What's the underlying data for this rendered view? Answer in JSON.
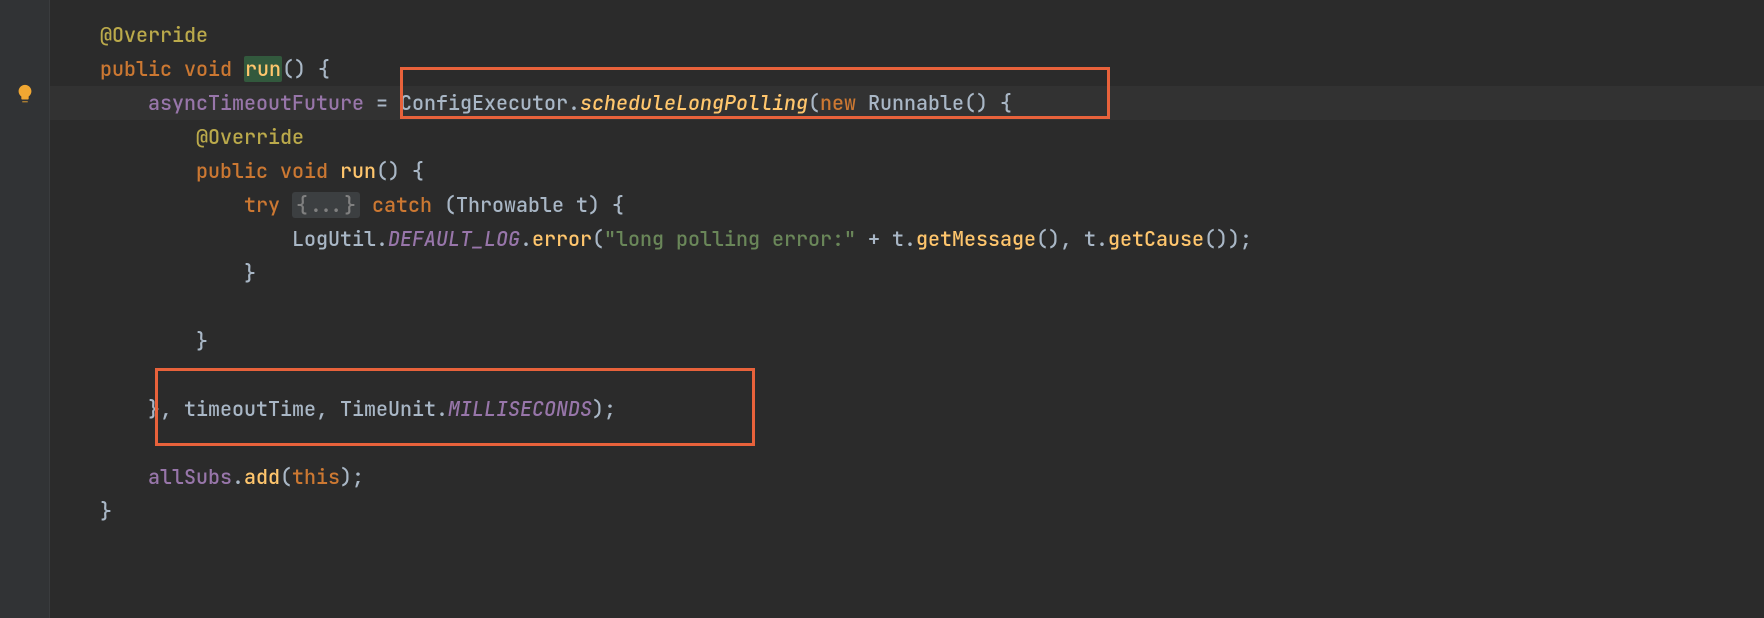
{
  "icons": {
    "bulb": "lightbulb-icon"
  },
  "code": {
    "l1": {
      "annot": "@Override"
    },
    "l2": {
      "kw1": "public",
      "kw2": "void",
      "name": "run",
      "p": "() {"
    },
    "l3": {
      "field": "asyncTimeoutFuture",
      "eq": " = ",
      "cls": "ConfigExecutor",
      "dot": ".",
      "m": "scheduleLongPolling",
      "open": "(",
      "kwnew": "new",
      "sp": " ",
      "rtype": "Runnable",
      "tail": "() {"
    },
    "l4": {
      "annot": "@Override"
    },
    "l5": {
      "kw1": "public",
      "kw2": "void",
      "name": "run",
      "p": "() {"
    },
    "l6": {
      "kwtry": "try",
      "fold": "{...}",
      "kwcatch": "catch",
      "args": "(Throwable t) {",
      "sp": " "
    },
    "l7": {
      "cls": "LogUtil",
      "dot1": ".",
      "fld": "DEFAULT_LOG",
      "dot2": ".",
      "m1": "error",
      "open": "(",
      "str": "\"long polling error:\"",
      "plus": " + t.",
      "m2": "getMessage",
      "mid": "(), t.",
      "m3": "getCause",
      "end": "());"
    },
    "l8": {
      "brace": "}"
    },
    "l9": {
      "blank": ""
    },
    "l10": {
      "brace": "}"
    },
    "l11": {
      "blank": ""
    },
    "l12": {
      "close": "}, ",
      "arg1": "timeoutTime",
      "comma": ", ",
      "tu": "TimeUnit",
      "dot": ".",
      "unit": "MILLISECONDS",
      "end": ");"
    },
    "l13": {
      "blank": ""
    },
    "l14": {
      "fld": "allSubs",
      "dot": ".",
      "m": "add",
      "open": "(",
      "kwthis": "this",
      "end": ");"
    },
    "l15": {
      "brace": "}"
    }
  }
}
